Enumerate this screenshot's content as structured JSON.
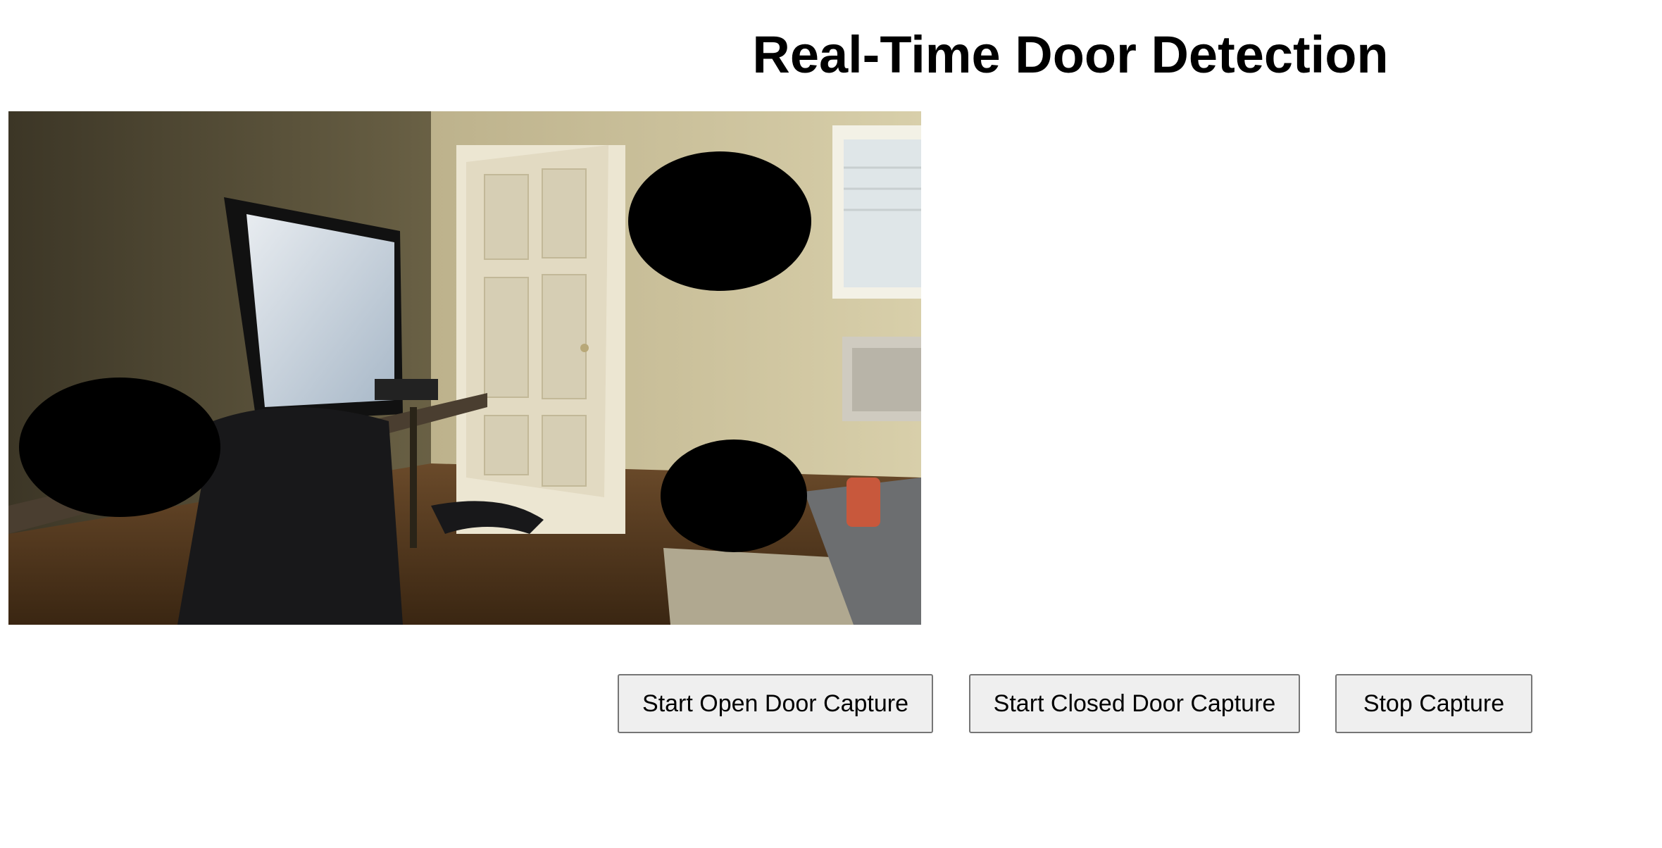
{
  "page": {
    "title": "Real-Time Door Detection"
  },
  "video": {
    "description_icon": "camera-feed"
  },
  "controls": {
    "open_label": "Start Open Door Capture",
    "closed_label": "Start Closed Door Capture",
    "stop_label": "Stop Capture"
  },
  "colors": {
    "button_bg": "#efefef",
    "button_border": "#767676",
    "text": "#000000"
  }
}
